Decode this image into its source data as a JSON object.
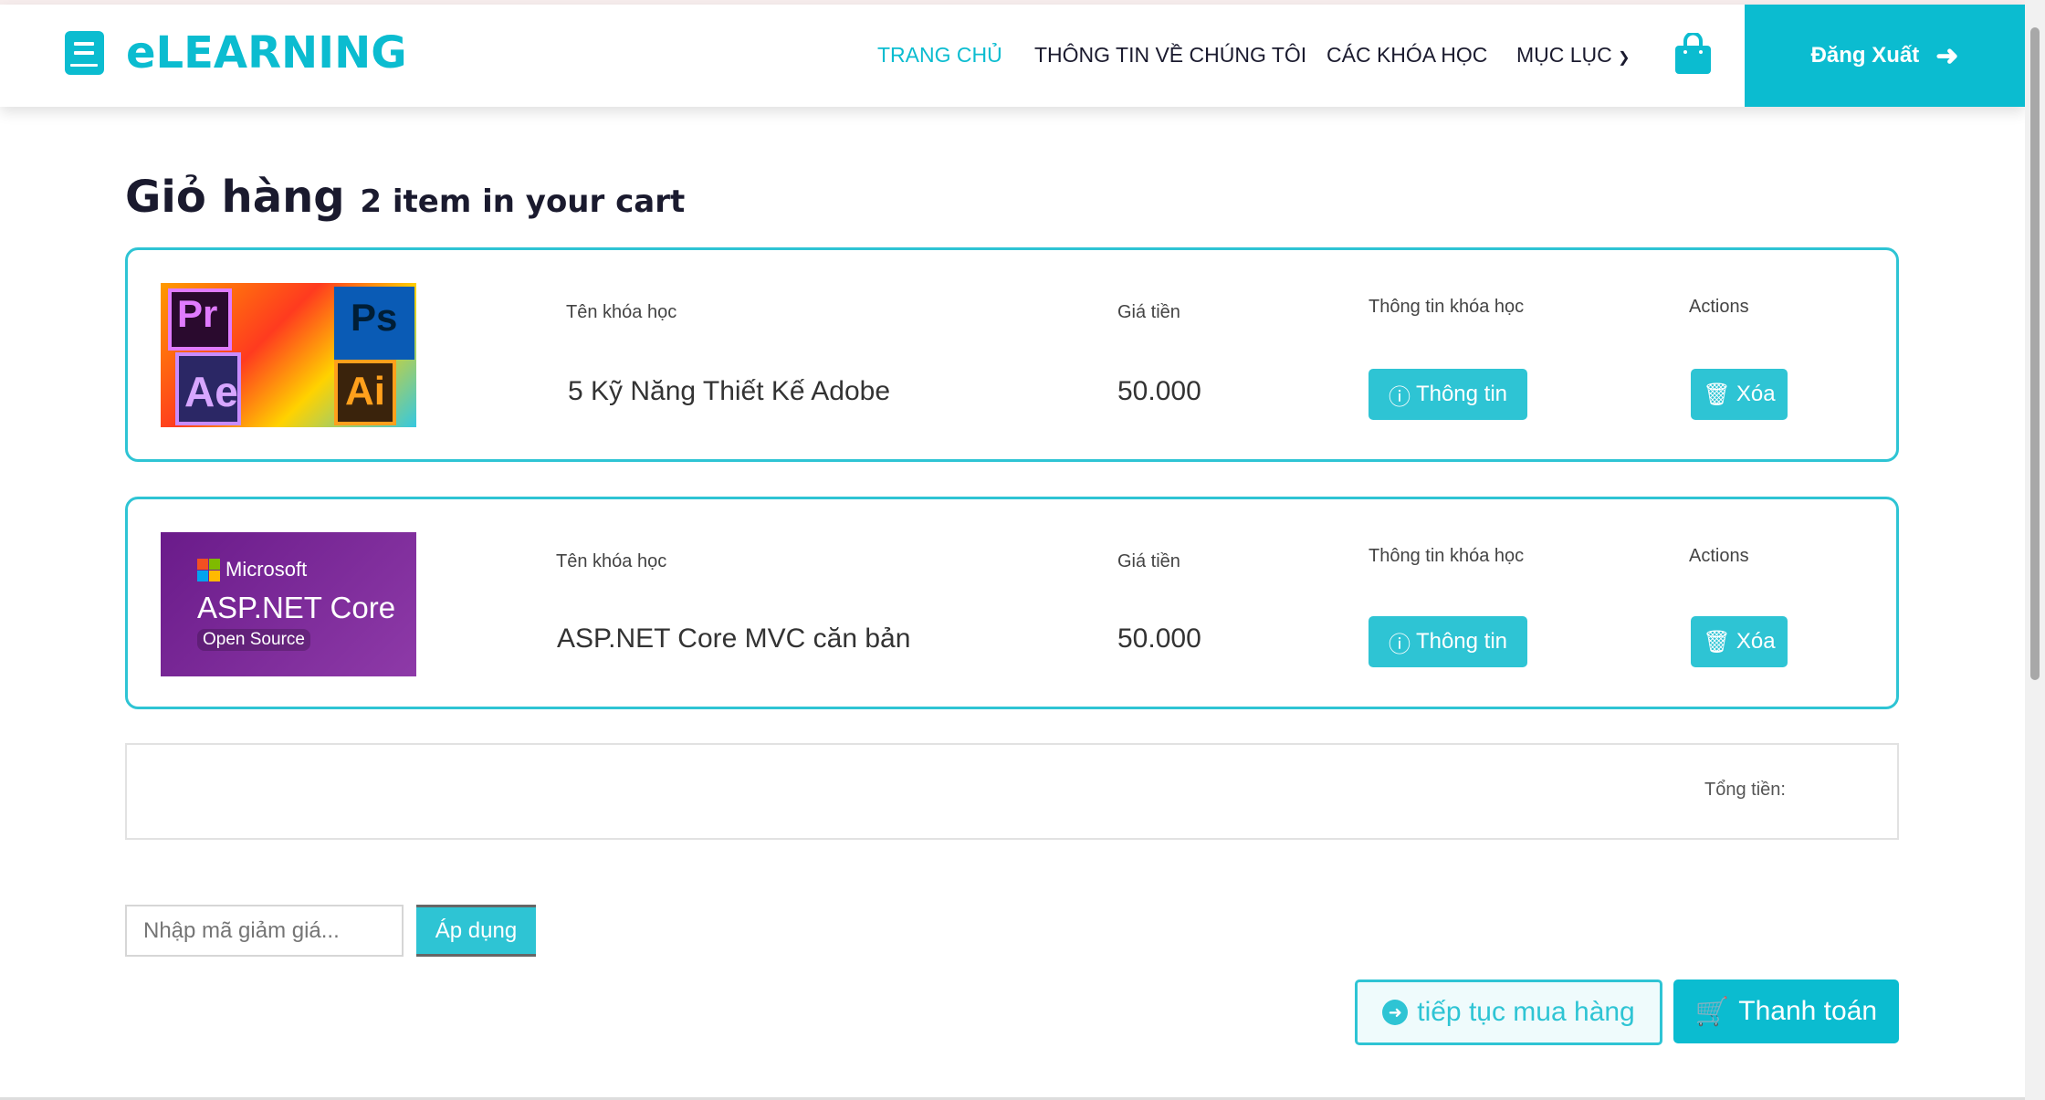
{
  "brand": {
    "name": "eLEARNING"
  },
  "nav": {
    "home": "TRANG CHỦ",
    "about": "THÔNG TIN VỀ CHÚNG TÔI",
    "courses": "CÁC KHÓA HỌC",
    "menu": "MỤC LỤC",
    "logout": "Đăng Xuất"
  },
  "page": {
    "title": "Giỏ hàng",
    "subtitle": "2 item in your cart"
  },
  "columns": {
    "name": "Tên khóa học",
    "price": "Giá tiền",
    "info": "Thông tin khóa học",
    "actions": "Actions"
  },
  "items": [
    {
      "name": "5 Kỹ Năng Thiết Kế Adobe",
      "price": "50.000",
      "info_button": "Thông tin",
      "delete_button": "Xóa",
      "image_labels": [
        "Pr",
        "Ps",
        "Ae",
        "Ai"
      ]
    },
    {
      "name": "ASP.NET Core MVC căn bản",
      "price": "50.000",
      "info_button": "Thông tin",
      "delete_button": "Xóa",
      "image_labels": [
        "Microsoft",
        "ASP.NET Core",
        "Open Source"
      ]
    }
  ],
  "total": {
    "label": "Tổng tiền:"
  },
  "coupon": {
    "placeholder": "Nhập mã giảm giá...",
    "apply": "Áp dụng"
  },
  "actions": {
    "continue": "tiếp tục mua hàng",
    "checkout": "Thanh toán"
  },
  "colors": {
    "accent": "#0bbcd0",
    "border": "#2ec4d4"
  }
}
